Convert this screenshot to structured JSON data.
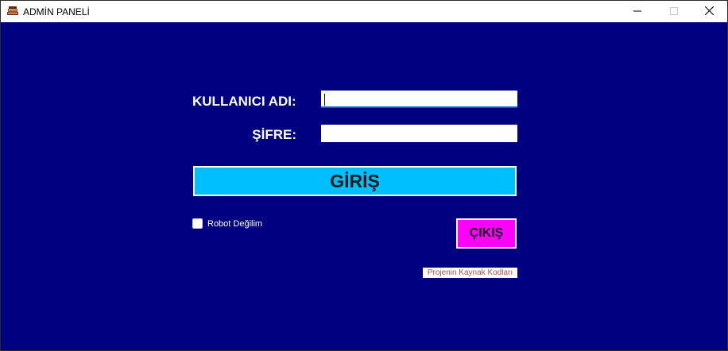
{
  "window": {
    "title": "ADMİN PANELİ",
    "icon": "book-stack-icon",
    "controls": {
      "minimize": "minimize-icon",
      "maximize": "maximize-icon",
      "close": "close-icon"
    },
    "background_color": "#000080"
  },
  "form": {
    "username_label": "KULLANICI ADI:",
    "username_value": "",
    "password_label": "ŞİFRE:",
    "password_value": "",
    "login_button": "GİRİŞ",
    "login_button_color": "#00bfff",
    "robot_checkbox_label": "Robot Değilim",
    "robot_checked": false,
    "exit_button": "ÇIKIŞ",
    "exit_button_color": "#ff00ff",
    "source_link": "Projenin Kaynak Kodları"
  }
}
